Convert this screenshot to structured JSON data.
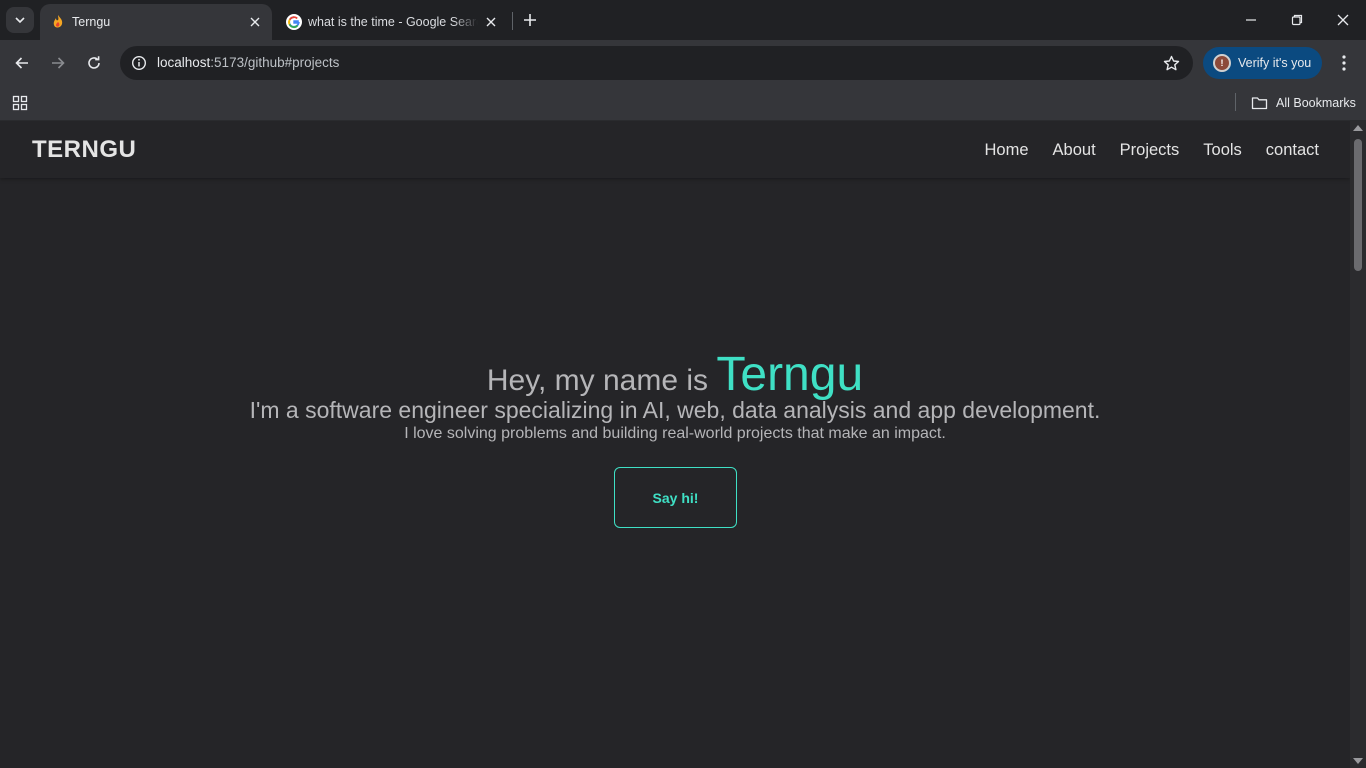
{
  "browser": {
    "tabs": [
      {
        "title": "Terngu",
        "favicon": "flame-favicon-icon",
        "active": true
      },
      {
        "title": "what is the time - Google Search",
        "favicon": "google-g-icon",
        "active": false
      }
    ],
    "address": {
      "host": "localhost",
      "path": ":5173/github#projects"
    },
    "verify_label": "Verify it's you",
    "bookmarks_label": "All Bookmarks"
  },
  "site": {
    "logo": "TERNGU",
    "nav": [
      "Home",
      "About",
      "Projects",
      "Tools",
      "contact"
    ]
  },
  "hero": {
    "greeting": "Hey, my name is",
    "name": "Terngu",
    "headline": "I'm a software engineer specializing in AI, web, data analysis and app development.",
    "tagline": "I love solving problems and building real-world projects that make an impact.",
    "cta_label": "Say hi!"
  },
  "colors": {
    "accent": "#3fe0c5",
    "page_bg": "#252528",
    "chrome_bg": "#35363a",
    "verify_bg": "#0b4a80"
  }
}
